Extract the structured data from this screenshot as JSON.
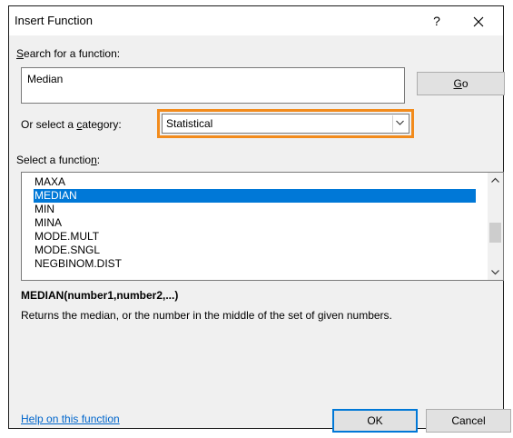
{
  "window": {
    "title": "Insert Function",
    "help_glyph": "?",
    "close_glyph": "✕"
  },
  "search": {
    "label_prefix": "",
    "label_accel": "S",
    "label_rest": "earch for a function:",
    "value": "Median",
    "go_prefix": "",
    "go_accel": "G",
    "go_rest": "o"
  },
  "category": {
    "label_prefix": "Or select a ",
    "label_accel": "c",
    "label_rest": "ategory:",
    "selected": "Statistical",
    "highlight_color": "#f28b1c"
  },
  "functions": {
    "label_prefix": "Select a functio",
    "label_accel": "n",
    "label_rest": ":",
    "items": [
      "MAXA",
      "MEDIAN",
      "MIN",
      "MINA",
      "MODE.MULT",
      "MODE.SNGL",
      "NEGBINOM.DIST"
    ],
    "selected_index": 1,
    "selection_color": "#0078d7"
  },
  "details": {
    "signature": "MEDIAN(number1,number2,...)",
    "description": "Returns the median, or the number in the middle of the set of given numbers."
  },
  "footer": {
    "help_link": "Help on this function",
    "ok_label": "OK",
    "cancel_label": "Cancel"
  }
}
